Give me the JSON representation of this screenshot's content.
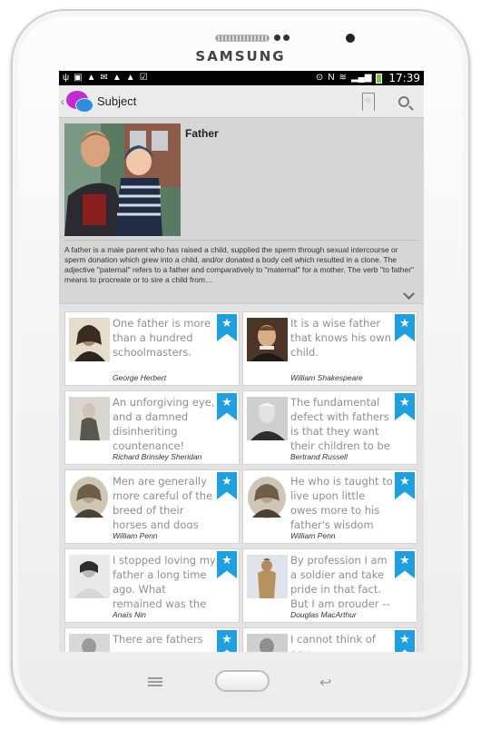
{
  "device": {
    "brand": "SAMSUNG"
  },
  "status_bar": {
    "time": "17:39"
  },
  "action_bar": {
    "title": "Subject"
  },
  "subject": {
    "name": "Father",
    "description": "A father is a male parent who has raised a child, supplied the sperm through sexual intercourse or sperm donation which grew into a child, and/or donated a body cell which resulted in a clone. The adjective \"paternal\" refers to a father and comparatively to \"maternal\" for a mother. The verb \"to father\" means to procreate or to sire a child from…"
  },
  "quotes": [
    {
      "text": "One father is more than a hundred schoolmasters.",
      "author": "George Herbert"
    },
    {
      "text": "It is a wise father that knows his own child.",
      "author": "William Shakespeare"
    },
    {
      "text": "An unforgiving eye, and a damned disinheriting countenance!",
      "author": "Richard Brinsley Sheridan"
    },
    {
      "text": "The fundamental defect with fathers is that they want their children to be a cred…",
      "author": "Bertrand Russell"
    },
    {
      "text": "Men are generally more careful of the breed of their horses and dogs than of…",
      "author": "William Penn"
    },
    {
      "text": "He who is taught to live upon little owes more to his father's wisdom than he wh…",
      "author": "William Penn"
    },
    {
      "text": "I stopped loving my father a long time ago. What remained was the slavery to a…",
      "author": "Anaïs Nin"
    },
    {
      "text": "By profession I am a soldier and take pride in that fact. But I am prouder -- infinitely…",
      "author": "Douglas MacArthur"
    },
    {
      "text": "There are fathers",
      "author": ""
    },
    {
      "text": "I cannot think of any",
      "author": ""
    }
  ]
}
